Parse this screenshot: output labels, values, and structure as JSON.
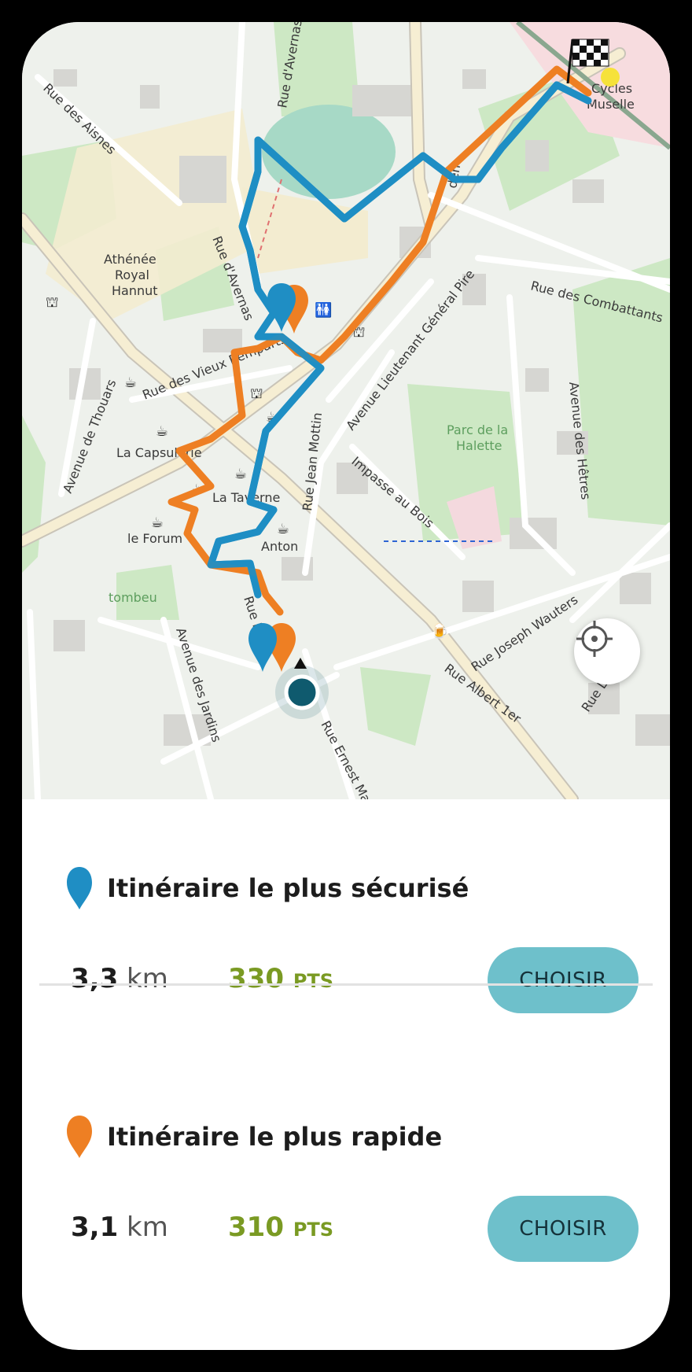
{
  "map": {
    "labels": {
      "rue_des_aisnes": "Rue des Aisnes",
      "rue_davernas_top": "Rue d'Avernas",
      "rue_davernas_mid": "Rue d'Avernas",
      "athenee_1": "Athénée",
      "athenee_2": "Royal",
      "athenee_3": "Hannut",
      "rue_des_vieux_remparts": "Rue des Vieux Remparts",
      "rue_des_combattants": "Rue des Combattants",
      "avenue_lieutenant": "Avenue Lieutenant Général Pire",
      "parc_1": "Parc de la",
      "parc_2": "Halette",
      "avenue_des_hetres": "Avenue des Hêtres",
      "avenue_de_thouars": "Avenue de Thouars",
      "la_capsulerie": "La Capsulerie",
      "la_taverne": "La Taverne",
      "rue_jean_mottin": "Rue Jean Mottin",
      "impasse_au_bois": "Impasse au Bois",
      "le_forum": "le Forum",
      "anton": "Anton",
      "tombeu": "tombeu",
      "avenue_des_jardins": "Avenue des Jardins",
      "rue_ernest": "Rue Ernest Malvoz",
      "rue_albert": "Rue Albert 1er",
      "rue_joseph_wauters": "Rue Joseph Wauters",
      "rue_lou": "Rue Lou",
      "cycles_1": "Cycles",
      "cycles_2": "Muselle",
      "rue_e": "Rue E",
      "rue_den": "den"
    },
    "colors": {
      "safe_route": "#1f8ec4",
      "fast_route": "#ee7f23",
      "position": "#0f5a6e"
    }
  },
  "routes": [
    {
      "pin_color": "#1f8ec4",
      "title": "Itinéraire le plus sécurisé",
      "distance_value": "3,3",
      "distance_unit": "km",
      "points_value": "330",
      "points_unit": "PTS",
      "button_label": "CHOISIR"
    },
    {
      "pin_color": "#ee7f23",
      "title": "Itinéraire le plus rapide",
      "distance_value": "3,1",
      "distance_unit": "km",
      "points_value": "310",
      "points_unit": "PTS",
      "button_label": "CHOISIR"
    }
  ]
}
